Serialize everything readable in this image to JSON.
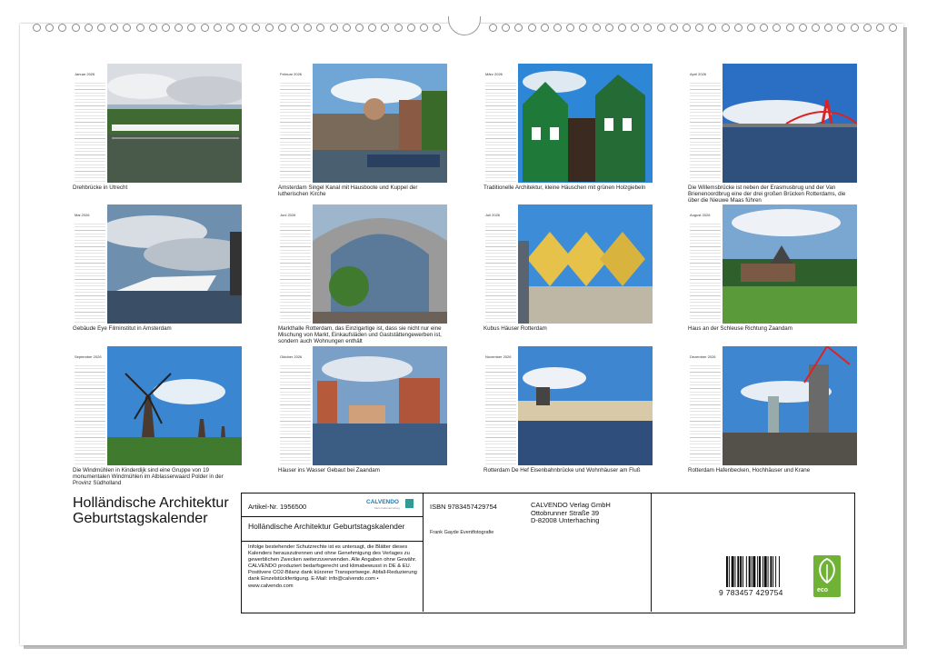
{
  "months": [
    {
      "label": "Januar 2026",
      "caption": "Drehbrücke in Utrecht",
      "scene": "bridge"
    },
    {
      "label": "Februar 2026",
      "caption": "Amsterdam Singel Kanal mit Hausboote und Kuppel der lutherischen Kirche",
      "scene": "canal"
    },
    {
      "label": "März 2026",
      "caption": "Traditionelle Architektur, kleine Häuschen mit grünen Holzgiebeln",
      "scene": "greenhouses"
    },
    {
      "label": "April 2026",
      "caption": "Die Willemsbrücke ist neben der Erasmusbrug und der Van Brienenoordbrug eine der drei großen Brücken Rotterdams, die über die Nieuwe Maas führen",
      "scene": "redbridge"
    },
    {
      "label": "Mai 2026",
      "caption": "Gebäude Eye Filminstitut in Amsterdam",
      "scene": "eye"
    },
    {
      "label": "Juni 2026",
      "caption": "Markthalle Rotterdam, das Einzigartige ist, dass sie nicht nur eine Mischung von Markt, Einkaufsläden und Gaststättengewerben ist, sondern auch Wohnungen enthält",
      "scene": "markthal"
    },
    {
      "label": "Juli 2026",
      "caption": "Kubus Häuser Rotterdam",
      "scene": "cubes"
    },
    {
      "label": "August 2026",
      "caption": "Haus an der Schleuse Richtung Zaandam",
      "scene": "lawn"
    },
    {
      "label": "September 2026",
      "caption": "Die Windmühlen in Kinderdijk sind eine Gruppe von 19 monumentalen Windmühlen im Alblasserwaard Polder in der Provinz Südholland",
      "scene": "windmills"
    },
    {
      "label": "Oktober 2026",
      "caption": "Häuser ins Wasser Gebaut bei Zaandam",
      "scene": "waterhouses"
    },
    {
      "label": "November 2026",
      "caption": "Rotterdam De Hef Eisenbahnbrücke und Wohnhäuser am Fluß",
      "scene": "riverside"
    },
    {
      "label": "Dezember 2026",
      "caption": "Rotterdam Hafenbecken, Hochhäuser und Krane",
      "scene": "skyline"
    }
  ],
  "title": "Holländische Architektur Geburtstagskalender",
  "info": {
    "article_no": "Artikel-Nr. 1956500",
    "logo": "CALVENDO",
    "logo_tagline": "Mein Kalenderverlag",
    "product_title": "Holländische Architektur Geburtstagskalender",
    "legal": "Infolge bestehender Schutzrechte ist es untersagt, die Blätter dieses Kalenders herauszutrennen und ohne Genehmigung des Verlages zu gewerblichen Zwecken weiterzuverwenden. Alle Angaben ohne Gewähr. CALVENDO produziert bedarfsgerecht und klimabewusst in DE & EU. Positivere CO2-Bilanz dank kürzerer Transportwege. Abfall-Reduzierung dank Einzelstückfertigung. E-Mail: info@calvendo.com • www.calvendo.com",
    "isbn": "ISBN 9783457429754",
    "publisher_name": "CALVENDO Verlag GmbH",
    "publisher_street": "Ottobrunner Straße 39",
    "publisher_city": "D-82008 Unterhaching",
    "author": "Frank Gayde Eventfotografie",
    "barcode_number": "9 783457 429754",
    "eco_label": "eco"
  },
  "colors": {
    "accent": "#2f9b95",
    "eco": "#6fb236",
    "logo": "#1d7bb0"
  }
}
